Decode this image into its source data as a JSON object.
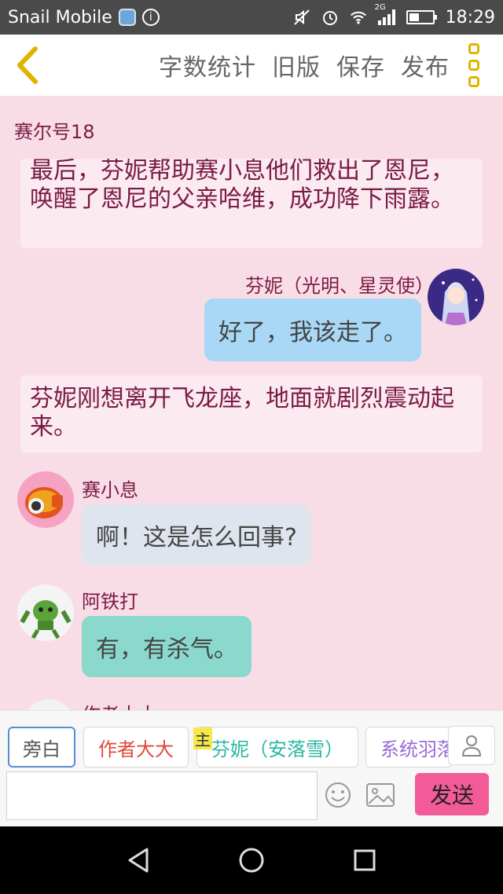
{
  "status_bar": {
    "carrier": "Snail Mobile",
    "network": "2G",
    "time": "18:29",
    "icons": [
      "info-icon",
      "mute-icon",
      "alarm-icon",
      "wifi-icon",
      "signal-icon",
      "battery-icon"
    ]
  },
  "toolbar": {
    "back_icon": "chevron-left-icon",
    "word_count": "字数统计",
    "old_version": "旧版",
    "save": "保存",
    "publish": "发布",
    "menu_icon": "more-vertical-icon"
  },
  "chat": {
    "chapter_title": "赛尔号18",
    "narration_1": "最后，芬妮帮助赛小息他们救出了恩尼，唤醒了恩尼的父亲哈维，成功降下雨露。",
    "messages": [
      {
        "speaker": "芬妮（光明、星灵使）",
        "text": "好了，我该走了。"
      },
      {
        "speaker": "赛小息",
        "text": "啊！这是怎么回事?"
      },
      {
        "speaker": "阿铁打",
        "text": "有，有杀气。"
      }
    ],
    "narration_2": "芬妮刚想离开飞龙座，地面就剧烈震动起来。",
    "partial_speaker": "作者大大"
  },
  "roles": {
    "narration": "旁白",
    "author": "作者大大",
    "host_tag": "主",
    "fenni": "芬妮（安落雪）",
    "system": "系统羽落"
  },
  "composer": {
    "input_value": "",
    "send": "发送"
  },
  "colors": {
    "background": "#f9dde6",
    "send_button": "#f35a98",
    "narration_text": "#7a1b45",
    "fenni_bubble": "#a8d8f5",
    "atie_bubble": "#8ad9cc"
  }
}
